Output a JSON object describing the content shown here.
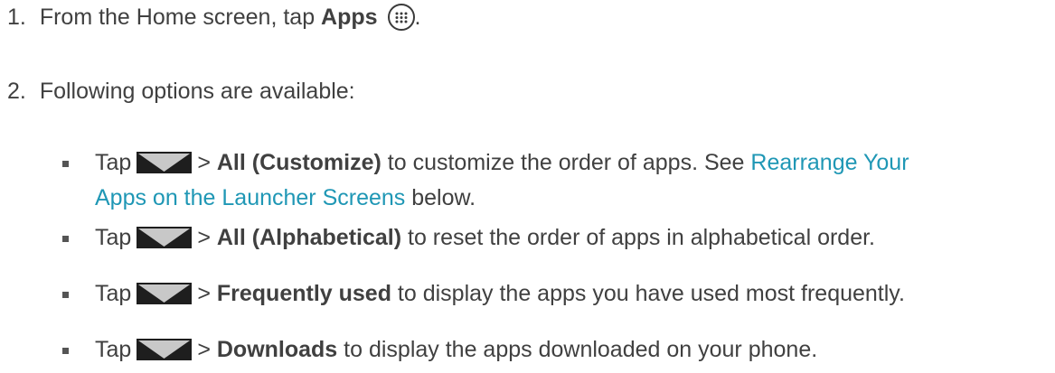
{
  "steps": [
    {
      "number": "1.",
      "text_before": "From the Home screen, tap ",
      "bold": "Apps",
      "icon": "apps-grid-icon",
      "text_after": "."
    },
    {
      "number": "2.",
      "text": "Following options are available:"
    }
  ],
  "options": [
    {
      "tap": "Tap",
      "icon": "dropdown-triangle-icon",
      "sep": ">",
      "bold": "All (Customize)",
      "text": " to customize the order of apps. See ",
      "link_line1": "Rearrange Your",
      "link_line2": "Apps on the Launcher Screens",
      "text_after": " below."
    },
    {
      "tap": "Tap",
      "icon": "dropdown-triangle-icon",
      "sep": ">",
      "bold": "All (Alphabetical)",
      "text": " to reset the order of apps in alphabetical order."
    },
    {
      "tap": "Tap",
      "icon": "dropdown-triangle-icon",
      "sep": ">",
      "bold": "Frequently used",
      "text": " to display the apps you have used most frequently."
    },
    {
      "tap": "Tap",
      "icon": "dropdown-triangle-icon",
      "sep": ">",
      "bold": "Downloads",
      "text": " to display the apps downloaded on your phone."
    }
  ],
  "colors": {
    "text": "#404040",
    "link": "#1f97b5",
    "icon_fill": "#c8c8c8",
    "icon_bg": "#1e1e1e"
  }
}
